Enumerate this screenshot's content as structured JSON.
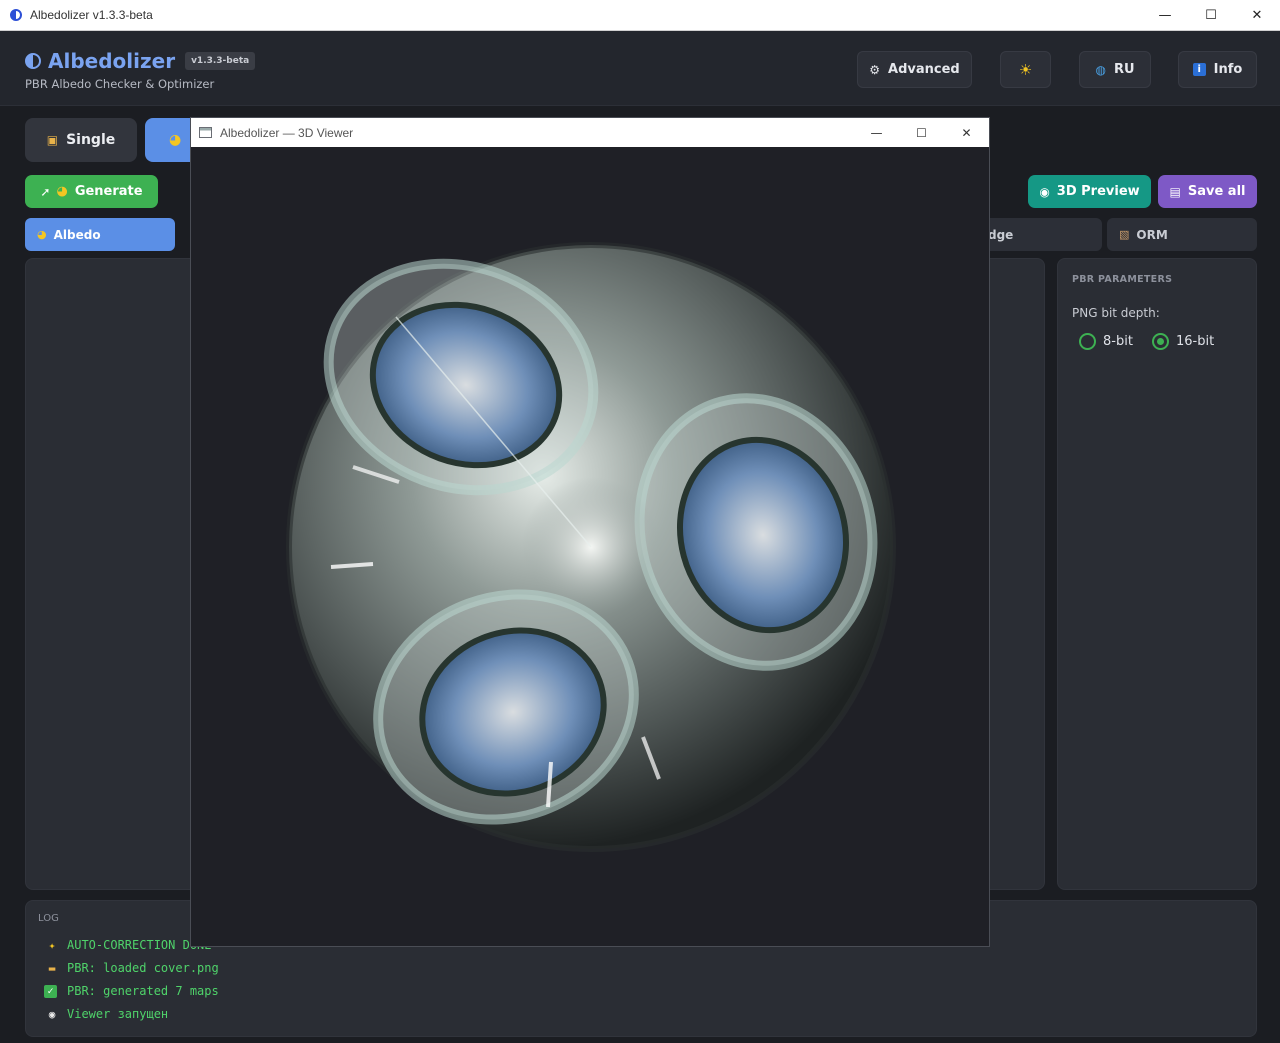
{
  "window": {
    "title": "Albedolizer v1.3.3-beta",
    "controls": [
      "—",
      "☐",
      "✕"
    ]
  },
  "header": {
    "app_name": "Albedolizer",
    "version": "v1.3.3-beta",
    "subtitle": "PBR Albedo Checker & Optimizer",
    "advanced_label": "Advanced",
    "theme_icon": "☀",
    "lang_label": "RU",
    "info_label": "Info"
  },
  "modes": {
    "single": "Single"
  },
  "actions": {
    "generate": "Generate",
    "preview_3d": "3D Preview",
    "save_all": "Save all"
  },
  "map_tabs": {
    "albedo": "Albedo",
    "edge": "dge",
    "orm": "ORM"
  },
  "params": {
    "section": "PBR PARAMETERS",
    "bit_depth_label": "PNG bit depth:",
    "options": [
      "8-bit",
      "16-bit"
    ],
    "selected": "16-bit"
  },
  "log": {
    "title": "LOG",
    "lines": [
      {
        "icon": "sparkles-icon",
        "text": "AUTO-CORRECTION DONE"
      },
      {
        "icon": "folder-icon",
        "text": "PBR: loaded cover.png"
      },
      {
        "icon": "check-icon",
        "text": "PBR: generated 7 maps"
      },
      {
        "icon": "eye-icon",
        "text": "Viewer запущен"
      }
    ]
  },
  "viewer": {
    "title": "Albedolizer — 3D Viewer",
    "controls": [
      "—",
      "☐",
      "✕"
    ]
  },
  "colors": {
    "accent_blue": "#5b8fe6",
    "green": "#3db152",
    "teal": "#159885",
    "purple": "#7e59c6",
    "log_green": "#4fd36a"
  }
}
